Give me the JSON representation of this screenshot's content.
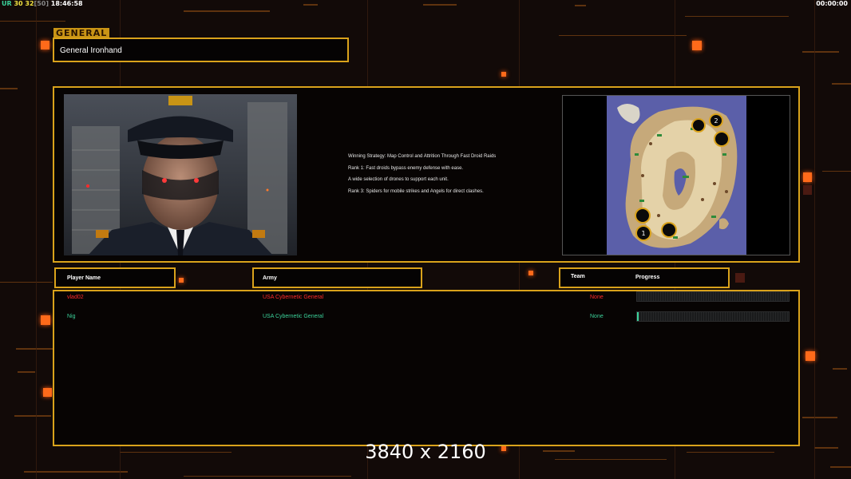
{
  "hud": {
    "ur_label": "UR",
    "fps_current": "30",
    "fps_target": "32",
    "fps_limit": "[50]",
    "clock": "18:46:58",
    "timer": "00:00:00"
  },
  "section_label": "GENERAL",
  "general_name": "General Ironhand",
  "strategy": {
    "lines": [
      "Winning Strategy: Map Control and Attrition Through Fast Droid Raids",
      "Rank 1: Fast droids bypass enemy defense with ease.",
      "A wide selection of drones to support each unit.",
      "Rank 3: Spiders for mobile strikes and Angels for direct clashes."
    ]
  },
  "minimap": {
    "start_positions": [
      "1",
      "2"
    ]
  },
  "headers": {
    "player_name": "Player Name",
    "army": "Army",
    "team": "Team",
    "progress": "Progress"
  },
  "players": [
    {
      "name": "vlad02",
      "army": "USA Cybernetic General",
      "team": "None",
      "progress": 0,
      "color": "#ff2a2a"
    },
    {
      "name": "Nig",
      "army": "USA Cybernetic General",
      "team": "None",
      "progress": 0.01,
      "color": "#3bd29a"
    }
  ],
  "resolution_caption": "3840 x 2160",
  "colors": {
    "frame": "#d9a21b",
    "accent_orange": "#ff6a1a",
    "ur_green": "#3bd29a"
  }
}
